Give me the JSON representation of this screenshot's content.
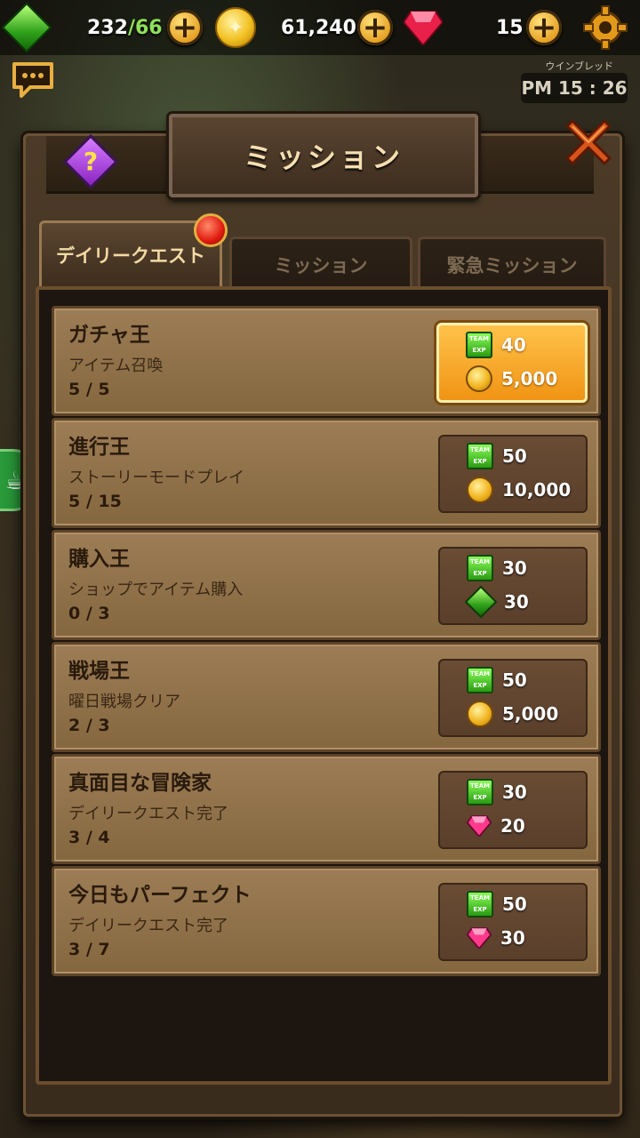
{
  "topbar": {
    "stamina": "232",
    "stamina_max": "/66",
    "gold": "61,240",
    "rubies": "15"
  },
  "clock": {
    "label": "ウインブレッド",
    "time": "PM 15 : 26"
  },
  "dialog": {
    "title": "ミッション"
  },
  "tabs": [
    {
      "label": "デイリークエスト",
      "active": true
    },
    {
      "label": "ミッション",
      "active": false
    },
    {
      "label": "緊急ミッション",
      "active": false
    }
  ],
  "missions": [
    {
      "title": "ガチャ王",
      "desc": "アイテム召喚",
      "progress": "5 / 5",
      "r1_icon": "team-exp-icon",
      "r1": "40",
      "r2_icon": "gold-coin-icon",
      "r2": "5,000",
      "claimable": true
    },
    {
      "title": "進行王",
      "desc": "ストーリーモードプレイ",
      "progress": "5 / 15",
      "r1_icon": "team-exp-icon",
      "r1": "50",
      "r2_icon": "gold-coin-icon",
      "r2": "10,000",
      "claimable": false
    },
    {
      "title": "購入王",
      "desc": "ショップでアイテム購入",
      "progress": "0 / 3",
      "r1_icon": "team-exp-icon",
      "r1": "30",
      "r2_icon": "green-gem-icon",
      "r2": "30",
      "claimable": false
    },
    {
      "title": "戦場王",
      "desc": "曜日戦場クリア",
      "progress": "2 / 3",
      "r1_icon": "team-exp-icon",
      "r1": "50",
      "r2_icon": "gold-coin-icon",
      "r2": "5,000",
      "claimable": false
    },
    {
      "title": "真面目な冒険家",
      "desc": "デイリークエスト完了",
      "progress": "3 / 4",
      "r1_icon": "team-exp-icon",
      "r1": "30",
      "r2_icon": "ruby-icon",
      "r2": "20",
      "claimable": false
    },
    {
      "title": "今日もパーフェクト",
      "desc": "デイリークエスト完了",
      "progress": "3 / 7",
      "r1_icon": "team-exp-icon",
      "r1": "50",
      "r2_icon": "ruby-icon",
      "r2": "30",
      "claimable": false
    }
  ],
  "team_exp_text": "TEAM EXP",
  "colors": {
    "accent_gold": "#f09414",
    "panel_brown": "#4a3a27",
    "row_tan": "#9c7d55"
  }
}
